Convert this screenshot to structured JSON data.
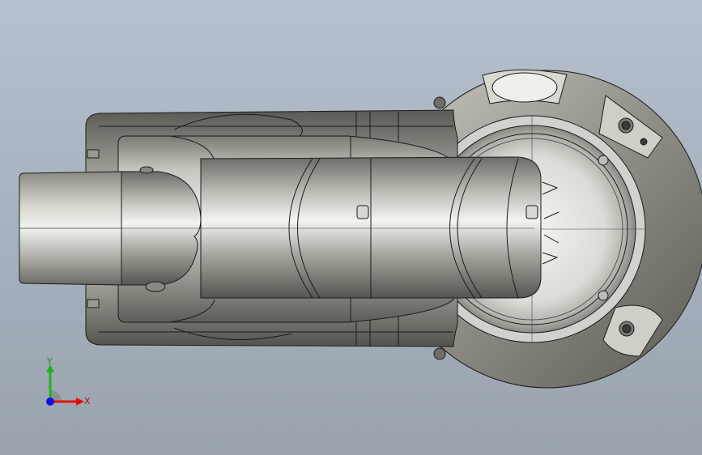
{
  "viewport": {
    "background_top": "#b6c0cc",
    "background_bottom": "#9aa3ad",
    "model_color": "#9a9a92",
    "edge_color": "#1a1a1a"
  },
  "triad": {
    "x_label": "X",
    "y_label": "Y",
    "x_color": "#e01010",
    "y_color": "#20b020",
    "z_color": "#1010e0"
  }
}
